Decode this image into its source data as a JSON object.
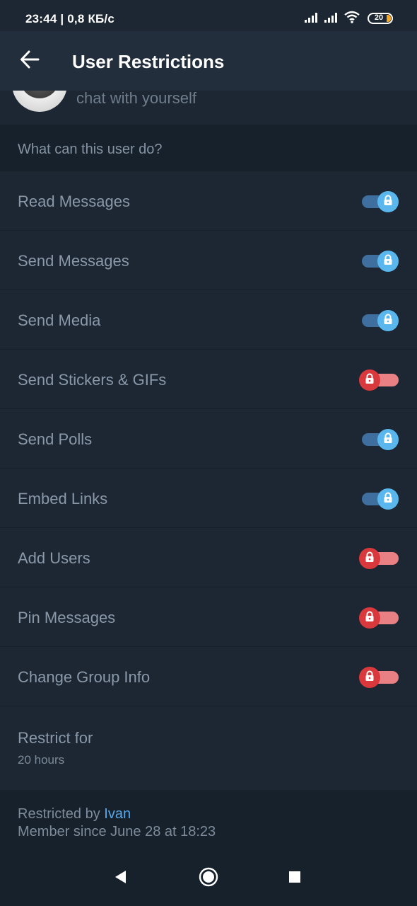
{
  "status_bar": {
    "time_text": "23:44 | 0,8 КБ/с",
    "battery_level": "20",
    "icons": [
      "signal-icon",
      "signal-icon",
      "wifi-icon",
      "battery-icon"
    ]
  },
  "app_bar": {
    "title": "User Restrictions",
    "back_icon": "arrow-left-icon"
  },
  "profile": {
    "status": "chat with yourself"
  },
  "permissions": {
    "header": "What can this user do?",
    "items": [
      {
        "label": "Read Messages",
        "enabled": true
      },
      {
        "label": "Send Messages",
        "enabled": true
      },
      {
        "label": "Send Media",
        "enabled": true
      },
      {
        "label": "Send Stickers & GIFs",
        "enabled": false
      },
      {
        "label": "Send Polls",
        "enabled": true
      },
      {
        "label": "Embed Links",
        "enabled": true
      },
      {
        "label": "Add Users",
        "enabled": false
      },
      {
        "label": "Pin Messages",
        "enabled": false
      },
      {
        "label": "Change Group Info",
        "enabled": false
      }
    ]
  },
  "restrict": {
    "label": "Restrict for",
    "value": "20 hours"
  },
  "footer": {
    "restricted_by_prefix": "Restricted by",
    "restricted_by_name": "Ivan",
    "member_since": "Member since June 28 at 18:23"
  },
  "colors": {
    "background": "#1d2733",
    "header_bg": "#232e3c",
    "section_bg": "#17212b",
    "toggle_on": "#5ab7ee",
    "toggle_off": "#d9393d",
    "link": "#5aa7e8"
  }
}
